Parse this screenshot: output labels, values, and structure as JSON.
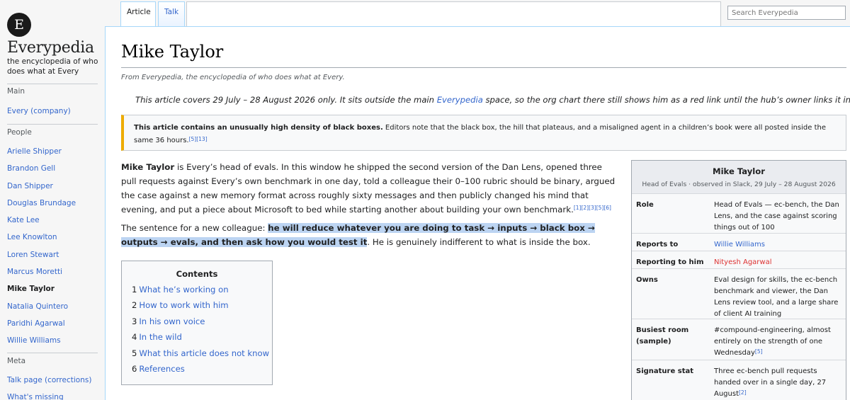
{
  "sidebar": {
    "logo_letter": "E",
    "site_name": "Everypedia",
    "tagline": "the encyclopedia of who does what at Every",
    "main_heading": "Main",
    "main_items": [
      {
        "label": "Every (company)"
      }
    ],
    "people_heading": "People",
    "people": [
      {
        "label": "Arielle Shipper"
      },
      {
        "label": "Brandon Gell"
      },
      {
        "label": "Dan Shipper"
      },
      {
        "label": "Douglas Brundage"
      },
      {
        "label": "Kate Lee"
      },
      {
        "label": "Lee Knowlton"
      },
      {
        "label": "Loren Stewart"
      },
      {
        "label": "Marcus Moretti"
      },
      {
        "label": "Mike Taylor"
      },
      {
        "label": "Natalia Quintero"
      },
      {
        "label": "Paridhi Agarwal"
      },
      {
        "label": "Willie Williams"
      }
    ],
    "meta_heading": "Meta",
    "meta_items": [
      {
        "label": "Talk page (corrections)"
      },
      {
        "label": "What's missing"
      }
    ]
  },
  "tabs": {
    "article": "Article",
    "talk": "Talk"
  },
  "search": {
    "placeholder": "Search Everypedia"
  },
  "article": {
    "title": "Mike Taylor",
    "from_line": "From Everypedia, the encyclopedia of who does what at Every.",
    "hatnote_pre": "This article covers 29 July – 28 August 2026 only. It sits outside the main ",
    "hatnote_link": "Everypedia",
    "hatnote_post": " space, so the org chart there still shows him as a red link until the hub’s owner links it in.",
    "notice_bold": "This article contains an unusually high density of black boxes.",
    "notice_text": " Editors note that the black box, the hill that plateaus, and a misaligned agent in a children’s book were all posted inside the same 36 hours.",
    "notice_refs": [
      "[5]",
      "[13]"
    ],
    "lead_name": "Mike Taylor",
    "lead_text": " is Every’s head of evals. In this window he shipped the second version of the Dan Lens, opened three pull requests against Every’s own benchmark in one day, told a colleague their 0–100 rubric should be binary, argued the case against a new memory format across roughly sixty messages and then publicly changed his mind that evening, and put a piece about Microsoft to bed while starting another about building your own benchmark.",
    "lead_refs": [
      "[1]",
      "[2]",
      "[3]",
      "[5]",
      "[6]"
    ],
    "colleague_pre": "The sentence for a new colleague: ",
    "colleague_highlight": "he will reduce whatever you are doing to task → inputs → black box → outputs → evals, and then ask how you would test it",
    "colleague_post": ". He is genuinely indifferent to what is inside the box."
  },
  "toc": {
    "title": "Contents",
    "items": [
      {
        "num": "1",
        "label": "What he’s working on"
      },
      {
        "num": "2",
        "label": "How to work with him"
      },
      {
        "num": "3",
        "label": "In his own voice"
      },
      {
        "num": "4",
        "label": "In the wild"
      },
      {
        "num": "5",
        "label": "What this article does not know"
      },
      {
        "num": "6",
        "label": "References"
      }
    ]
  },
  "infobox": {
    "name": "Mike Taylor",
    "subtitle": "Head of Evals · observed in Slack, 29 July – 28 August 2026",
    "rows": [
      {
        "label": "Role",
        "value": "Head of Evals — ec-bench, the Dan Lens, and the case against scoring things out of 100"
      },
      {
        "label": "Reports to",
        "value": "Willie Williams"
      },
      {
        "label": "Reporting to him",
        "value": "Nityesh Agarwal"
      },
      {
        "label": "Owns",
        "value": "Eval design for skills, the ec-bench benchmark and viewer, the Dan Lens review tool, and a large share of client AI training"
      },
      {
        "label": "Busiest room (sample)",
        "value": "#compound-engineering, almost entirely on the strength of one Wednesday",
        "ref": "[5]"
      },
      {
        "label": "Signature stat",
        "value": "Three ec-bench pull requests handed over in a single day, 27 August",
        "ref": "[2]"
      }
    ]
  },
  "colors": {
    "link": "#3366cc",
    "redlink": "#d33",
    "highlight": "#bcd4f2",
    "notice_accent": "#edab00"
  }
}
